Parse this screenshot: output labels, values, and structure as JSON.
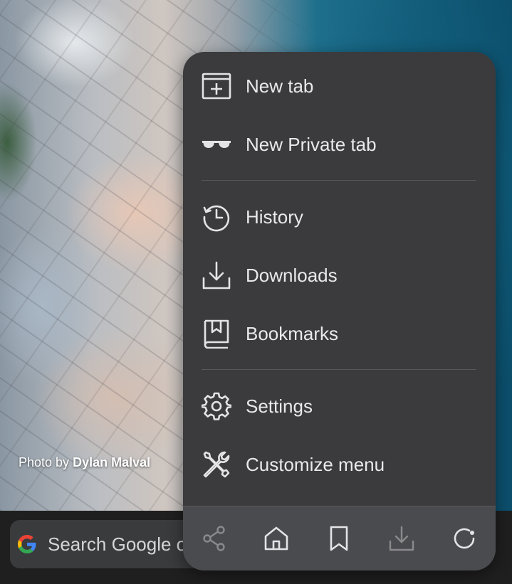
{
  "wallpaper": {
    "credit_prefix": "Photo by",
    "credit_author": "Dylan Malval"
  },
  "search": {
    "placeholder_visible": "Search Google o",
    "logo_icon": "google-g-icon"
  },
  "menu": {
    "items": [
      {
        "label": "New tab",
        "icon": "new-tab-icon"
      },
      {
        "label": "New Private tab",
        "icon": "private-glasses-icon"
      },
      {
        "label": "History",
        "icon": "history-icon"
      },
      {
        "label": "Downloads",
        "icon": "download-icon"
      },
      {
        "label": "Bookmarks",
        "icon": "bookmarks-book-icon"
      },
      {
        "label": "Settings",
        "icon": "gear-icon"
      },
      {
        "label": "Customize menu",
        "icon": "wrench-screwdriver-icon"
      }
    ],
    "toolbar": [
      {
        "name": "share",
        "icon": "share-icon",
        "enabled": false
      },
      {
        "name": "home",
        "icon": "home-icon",
        "enabled": true
      },
      {
        "name": "bookmark",
        "icon": "bookmark-icon",
        "enabled": true
      },
      {
        "name": "download",
        "icon": "download-icon",
        "enabled": false
      },
      {
        "name": "reload",
        "icon": "reload-icon",
        "enabled": true
      }
    ]
  },
  "colors": {
    "menu_bg": "#3b3b3d",
    "toolbar_bg": "#4a4b4e",
    "text": "#e9e9ea",
    "icon": "#e4e4e6",
    "icon_disabled": "#8a8a8d",
    "search_bg": "#3a3b3d"
  }
}
